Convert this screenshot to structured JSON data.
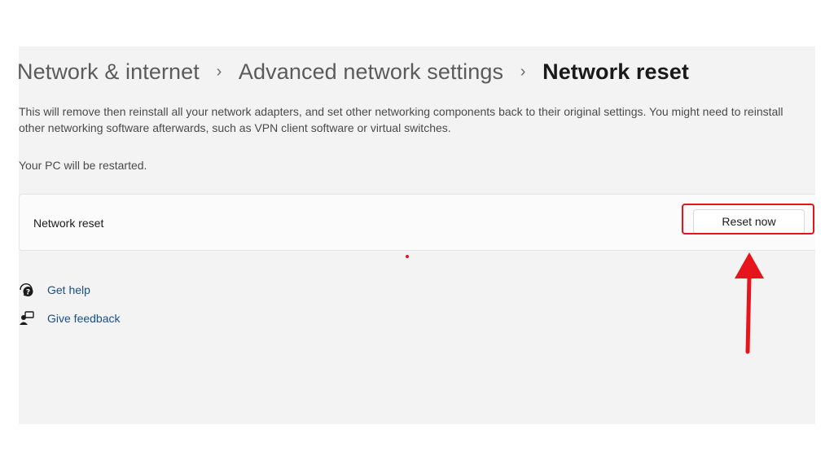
{
  "breadcrumb": {
    "items": [
      "Network & internet",
      "Advanced network settings",
      "Network reset"
    ],
    "separator": "›"
  },
  "description": "This will remove then reinstall all your network adapters, and set other networking components back to their original settings. You might need to reinstall other networking software afterwards, such as VPN client software or virtual switches.",
  "restart_note": "Your PC will be restarted.",
  "reset_card": {
    "label": "Network reset",
    "button_label": "Reset now"
  },
  "links": {
    "get_help": "Get help",
    "give_feedback": "Give feedback"
  },
  "icons": {
    "get_help": "help-chat-icon",
    "give_feedback": "feedback-person-icon"
  },
  "colors": {
    "annotation_red": "#e8141b",
    "link_blue": "#1a4f8a",
    "panel_bg": "#f3f3f3"
  }
}
